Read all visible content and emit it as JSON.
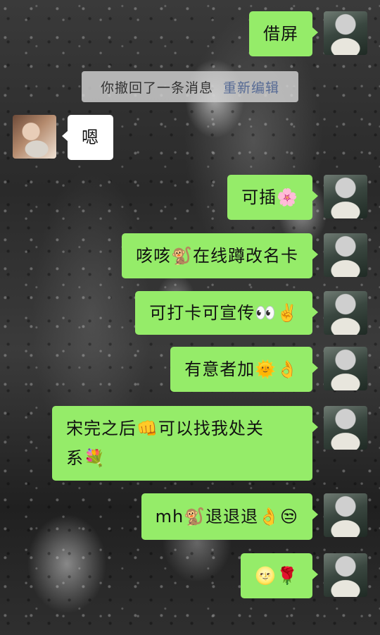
{
  "system_notice": {
    "text": "你撤回了一条消息",
    "action": "重新编辑"
  },
  "messages": [
    {
      "sender": "me",
      "text": "借屏"
    },
    {
      "sender": "other",
      "text": "嗯"
    },
    {
      "sender": "me",
      "text": "可插🌸"
    },
    {
      "sender": "me",
      "text": "咳咳🐒在线蹲改名卡"
    },
    {
      "sender": "me",
      "text": "可打卡可宣传👀✌️"
    },
    {
      "sender": "me",
      "text": "有意者加🌞👌"
    },
    {
      "sender": "me",
      "line1": "宋完之后👊可以找我处关",
      "line2": "系💐"
    },
    {
      "sender": "me",
      "text": "mh🐒退退退👌😒"
    },
    {
      "sender": "me",
      "text": "🌝🌹"
    }
  ],
  "colors": {
    "my_bubble": "#95ec69",
    "other_bubble": "#ffffff",
    "link": "#576b95"
  }
}
